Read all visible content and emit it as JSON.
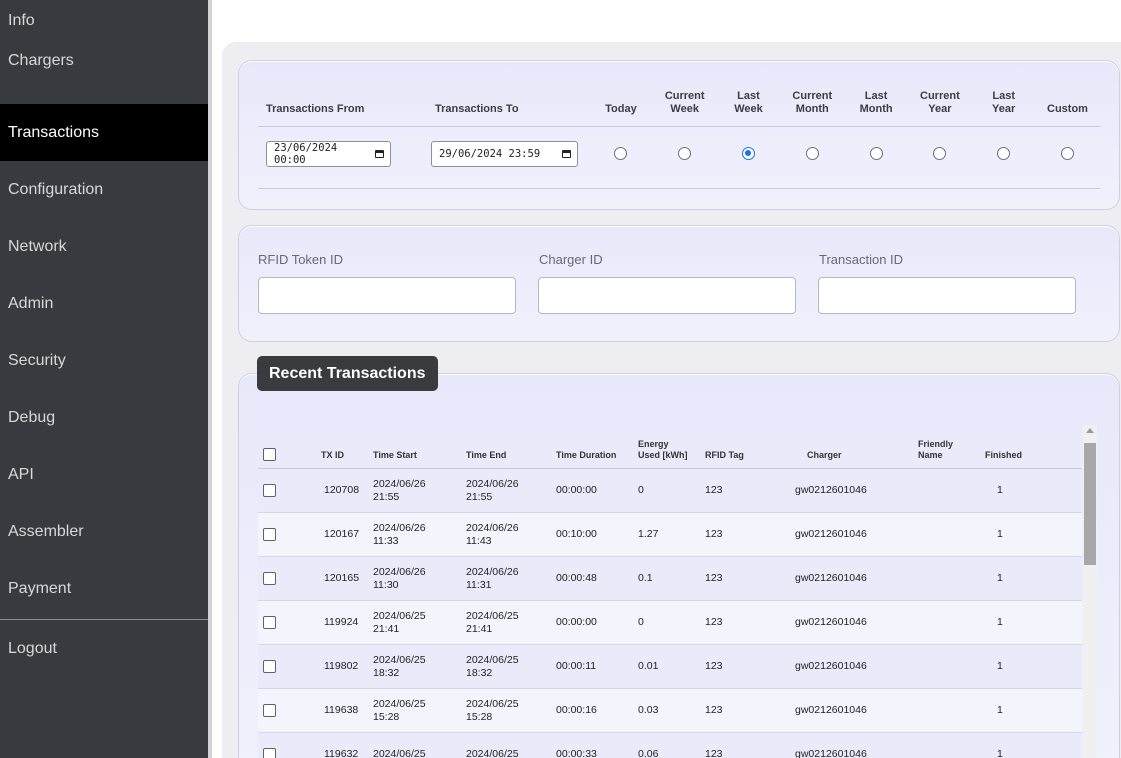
{
  "sidebar": {
    "items": [
      {
        "label": "Info"
      },
      {
        "label": "Chargers"
      },
      {
        "label": "Transactions"
      },
      {
        "label": "Configuration"
      },
      {
        "label": "Network"
      },
      {
        "label": "Admin"
      },
      {
        "label": "Security"
      },
      {
        "label": "Debug"
      },
      {
        "label": "API"
      },
      {
        "label": "Assembler"
      },
      {
        "label": "Payment"
      }
    ],
    "active_index": 2,
    "logout_label": "Logout"
  },
  "date_filter": {
    "from_label": "Transactions From",
    "to_label": "Transactions To",
    "from_value": "23/06/2024 00:00",
    "to_value": "29/06/2024 23:59",
    "ranges": [
      {
        "label_1": "Today",
        "label_2": "",
        "checked": false
      },
      {
        "label_1": "Current",
        "label_2": "Week",
        "checked": false
      },
      {
        "label_1": "Last",
        "label_2": "Week",
        "checked": true
      },
      {
        "label_1": "Current",
        "label_2": "Month",
        "checked": false
      },
      {
        "label_1": "Last",
        "label_2": "Month",
        "checked": false
      },
      {
        "label_1": "Current",
        "label_2": "Year",
        "checked": false
      },
      {
        "label_1": "Last",
        "label_2": "Year",
        "checked": false
      },
      {
        "label_1": "Custom",
        "label_2": "",
        "checked": false
      }
    ]
  },
  "text_filters": {
    "rfid_label": "RFID Token ID",
    "charger_label": "Charger ID",
    "transaction_label": "Transaction ID",
    "rfid_value": "",
    "charger_value": "",
    "transaction_value": ""
  },
  "recent": {
    "title": "Recent Transactions",
    "columns": {
      "tx_id": "TX ID",
      "time_start": "Time Start",
      "time_end": "Time End",
      "duration": "Time Duration",
      "energy_1": "Energy",
      "energy_2": "Used [kWh]",
      "rfid": "RFID Tag",
      "charger": "Charger",
      "friendly_1": "Friendly",
      "friendly_2": "Name",
      "finished": "Finished"
    },
    "rows": [
      {
        "id": "120708",
        "start_date": "2024/06/26",
        "start_time": "21:55",
        "end_date": "2024/06/26",
        "end_time": "21:55",
        "duration": "00:00:00",
        "energy": "0",
        "rfid": "123",
        "charger": "gw0212601046",
        "friendly": "",
        "finished": "1"
      },
      {
        "id": "120167",
        "start_date": "2024/06/26",
        "start_time": "11:33",
        "end_date": "2024/06/26",
        "end_time": "11:43",
        "duration": "00:10:00",
        "energy": "1.27",
        "rfid": "123",
        "charger": "gw0212601046",
        "friendly": "",
        "finished": "1"
      },
      {
        "id": "120165",
        "start_date": "2024/06/26",
        "start_time": "11:30",
        "end_date": "2024/06/26",
        "end_time": "11:31",
        "duration": "00:00:48",
        "energy": "0.1",
        "rfid": "123",
        "charger": "gw0212601046",
        "friendly": "",
        "finished": "1"
      },
      {
        "id": "119924",
        "start_date": "2024/06/25",
        "start_time": "21:41",
        "end_date": "2024/06/25",
        "end_time": "21:41",
        "duration": "00:00:00",
        "energy": "0",
        "rfid": "123",
        "charger": "gw0212601046",
        "friendly": "",
        "finished": "1"
      },
      {
        "id": "119802",
        "start_date": "2024/06/25",
        "start_time": "18:32",
        "end_date": "2024/06/25",
        "end_time": "18:32",
        "duration": "00:00:11",
        "energy": "0.01",
        "rfid": "123",
        "charger": "gw0212601046",
        "friendly": "",
        "finished": "1"
      },
      {
        "id": "119638",
        "start_date": "2024/06/25",
        "start_time": "15:28",
        "end_date": "2024/06/25",
        "end_time": "15:28",
        "duration": "00:00:16",
        "energy": "0.03",
        "rfid": "123",
        "charger": "gw0212601046",
        "friendly": "",
        "finished": "1"
      },
      {
        "id": "119632",
        "start_date": "2024/06/25",
        "start_time": "",
        "end_date": "2024/06/25",
        "end_time": "",
        "duration": "00:00:33",
        "energy": "0.06",
        "rfid": "123",
        "charger": "gw0212601046",
        "friendly": "",
        "finished": "1"
      }
    ]
  }
}
